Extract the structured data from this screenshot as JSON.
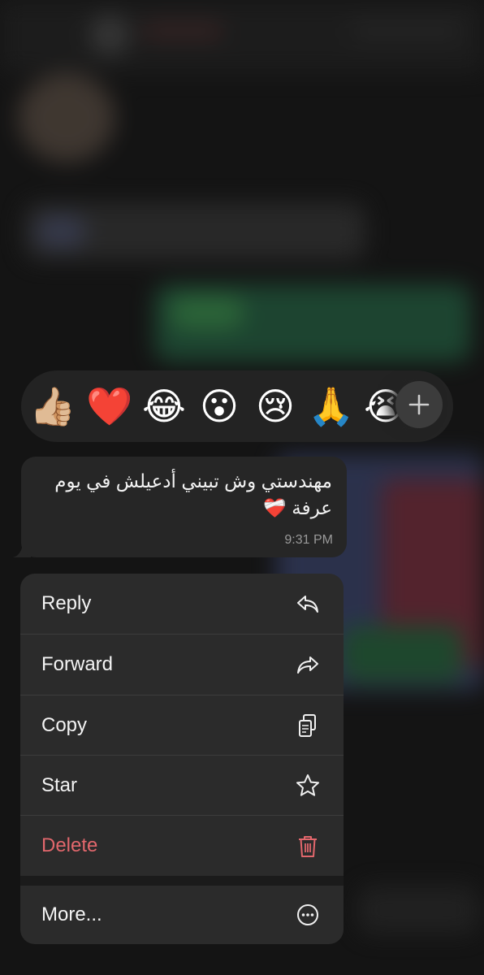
{
  "reactions": {
    "emojis": [
      "👍🏼",
      "❤️",
      "😂",
      "😮",
      "😢",
      "🙏",
      "😭"
    ],
    "add_icon": "plus-icon"
  },
  "message": {
    "text": "مهندستي وش تبيني أدعيلش في يوم عرفة ❤️‍🩹",
    "time": "9:31 PM"
  },
  "menu": {
    "reply": "Reply",
    "forward": "Forward",
    "copy": "Copy",
    "star": "Star",
    "delete": "Delete",
    "more": "More..."
  },
  "colors": {
    "destructive": "#e2676c",
    "menu_bg": "#2b2b2b",
    "bubble_bg": "#262626"
  }
}
